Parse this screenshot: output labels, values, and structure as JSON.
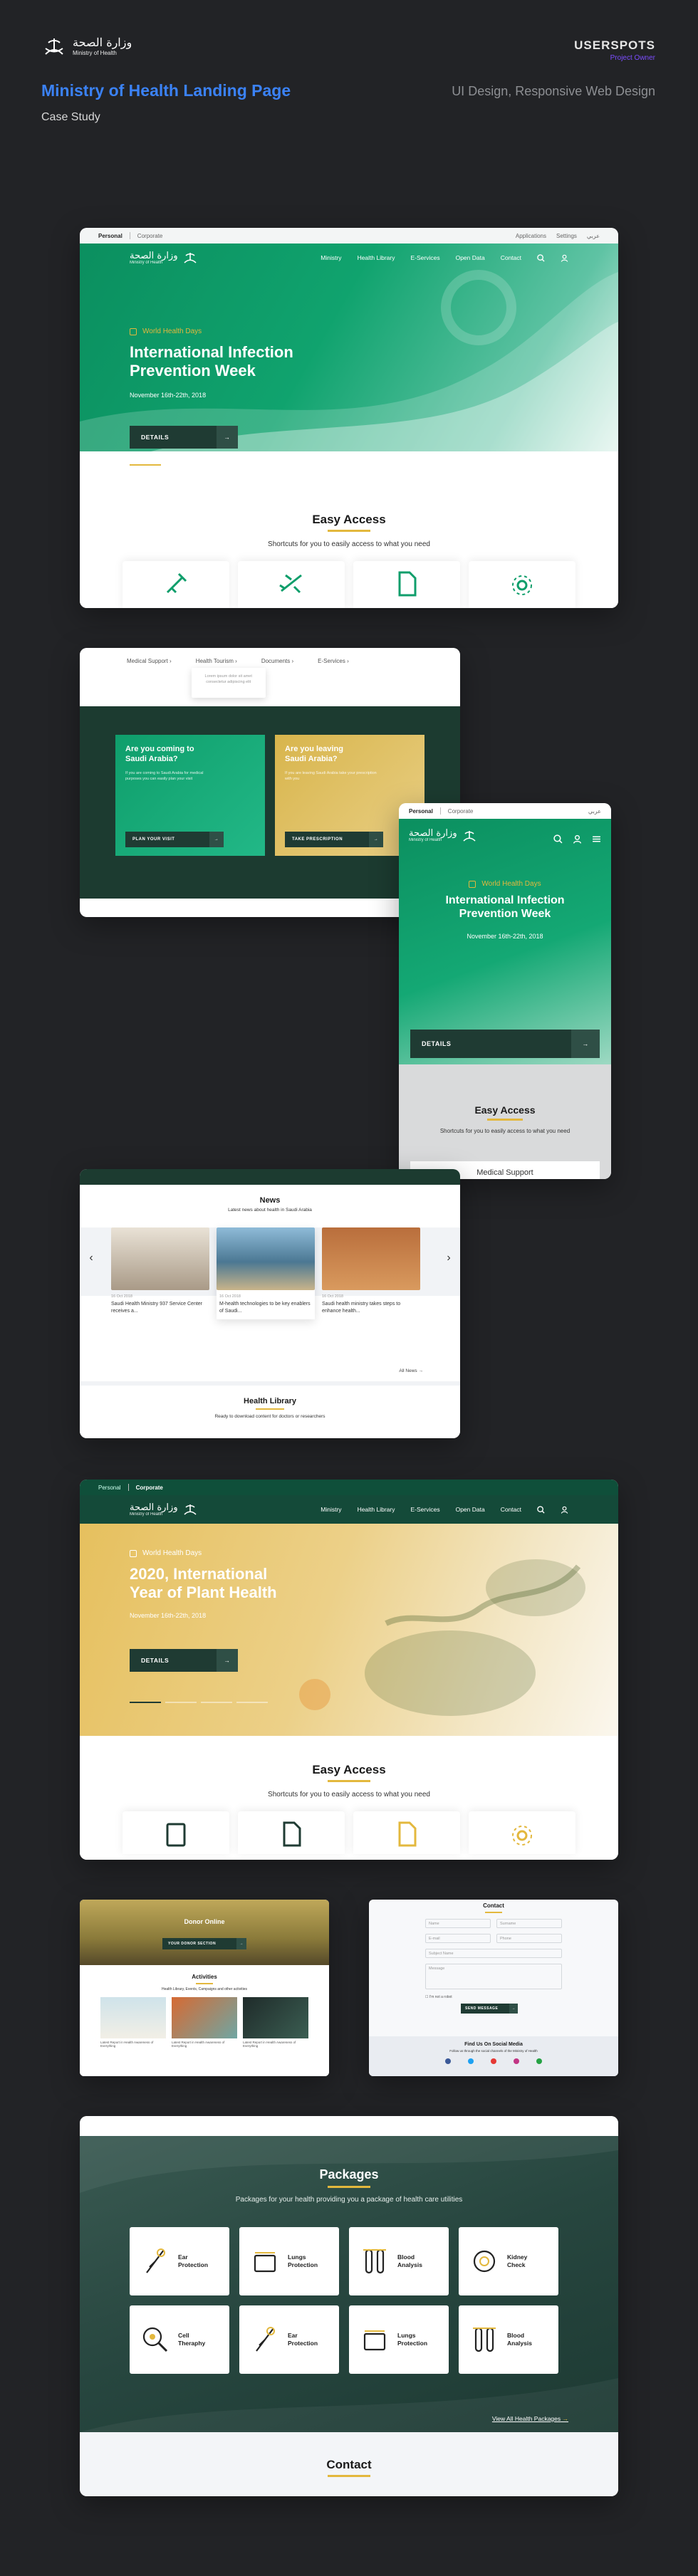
{
  "header": {
    "title": "Ministry of Health Landing Page",
    "subtitle": "Case Study",
    "brand": "USERSPOTS",
    "brand_role": "Project Owner",
    "services": "UI Design, Responsive Web Design"
  },
  "colors": {
    "page_bg": "#222326",
    "accent_blue": "#3b82f6",
    "brand_green": "#0f9e6b",
    "gold": "#e3b83d",
    "dark_green": "#1f3b33",
    "purple": "#7c4dff"
  },
  "site": {
    "logo_ar": "وزارة الصحة",
    "logo_en": "Ministry of Health",
    "tab_personal": "Personal",
    "tab_corporate": "Corporate",
    "util_applications": "Applications",
    "util_settings": "Settings",
    "util_lang": "عربي",
    "nav": [
      "Ministry",
      "Health Library",
      "E-Services",
      "Open Data",
      "Contact"
    ]
  },
  "hero1": {
    "tag": "World Health Days",
    "title_l1": "International Infection",
    "title_l2": "Prevention Week",
    "date": "November 16th-22th, 2018",
    "cta": "DETAILS"
  },
  "easy_access": {
    "title": "Easy Access",
    "subtitle": "Shortcuts for you to easily access to what you need"
  },
  "card2": {
    "tabs": [
      "Medical Support",
      "Health Tourism",
      "Documents",
      "E-Services"
    ],
    "dropdown_l1": "Lorem ipsum dolor sit amet",
    "dropdown_l2": "consectetur adipiscing elit",
    "promo1_title_l1": "Are you coming to",
    "promo1_title_l2": "Saudi Arabia?",
    "promo1_body": "If you are coming to Saudi Arabia for medical purposes you can easily plan your visit",
    "promo1_cta": "PLAN YOUR VISIT",
    "promo2_title_l1": "Are you leaving",
    "promo2_title_l2": "Saudi Arabia?",
    "promo2_body": "If you are leaving Saudi Arabia take your prescription with you",
    "promo2_cta": "TAKE PRESCRIPTION"
  },
  "mobile": {
    "title_l1": "International Infection",
    "title_l2": "Prevention Week",
    "date": "November 16th-22th, 2018",
    "cta": "DETAILS",
    "first_item": "Medical Support"
  },
  "news": {
    "title": "News",
    "subtitle": "Latest news about health in Saudi Arabia",
    "items": [
      {
        "date": "16 Oct 2018",
        "text": "Saudi Health Ministry 937 Service Center receives a..."
      },
      {
        "date": "16 Oct 2018",
        "text": "M-health technologies to be key enablers of Saudi..."
      },
      {
        "date": "16 Oct 2018",
        "text": "Saudi health ministry takes steps to enhance health..."
      }
    ],
    "all_link": "All News",
    "library_title": "Health Library",
    "library_subtitle": "Ready to download content for doctors or researchers"
  },
  "hero2": {
    "tag": "World Health Days",
    "title_l1": "2020, International",
    "title_l2": "Year of Plant Health",
    "date": "November 16th-22th, 2018",
    "cta": "DETAILS"
  },
  "small_left": {
    "title": "Donor Online",
    "cta": "YOUR DONOR SECTION",
    "activities": "Activities",
    "activities_sub": "Health Library, Events, Campaigns and other activities",
    "cap": "Latest Report in Health Awareness of Everything"
  },
  "small_right": {
    "title": "Contact",
    "name": "Name",
    "surname": "Surname",
    "email": "E-mail",
    "phone": "Phone",
    "subject": "Subject Name",
    "message": "Message",
    "check": "I'm not a robot",
    "send": "SEND MESSAGE",
    "social_title": "Find Us On Social Media",
    "social_sub": "Follow us through the social channels of the Ministry of Health"
  },
  "packages": {
    "title": "Packages",
    "subtitle": "Packages for your health providing you a package of health care utilities",
    "items": [
      {
        "l1": "Ear",
        "l2": "Protection",
        "icon": "ear-icon"
      },
      {
        "l1": "Lungs",
        "l2": "Protection",
        "icon": "lungs-icon"
      },
      {
        "l1": "Blood",
        "l2": "Analysis",
        "icon": "blood-tubes-icon"
      },
      {
        "l1": "Kidney",
        "l2": "Check",
        "icon": "kidney-icon"
      },
      {
        "l1": "Cell",
        "l2": "Theraphy",
        "icon": "cell-magnifier-icon"
      },
      {
        "l1": "Ear",
        "l2": "Protection",
        "icon": "ear-icon"
      },
      {
        "l1": "Lungs",
        "l2": "Protection",
        "icon": "lungs-icon"
      },
      {
        "l1": "Blood",
        "l2": "Analysis",
        "icon": "blood-tubes-icon"
      }
    ],
    "view_all": "View All Health Packages",
    "contact_title": "Contact"
  }
}
